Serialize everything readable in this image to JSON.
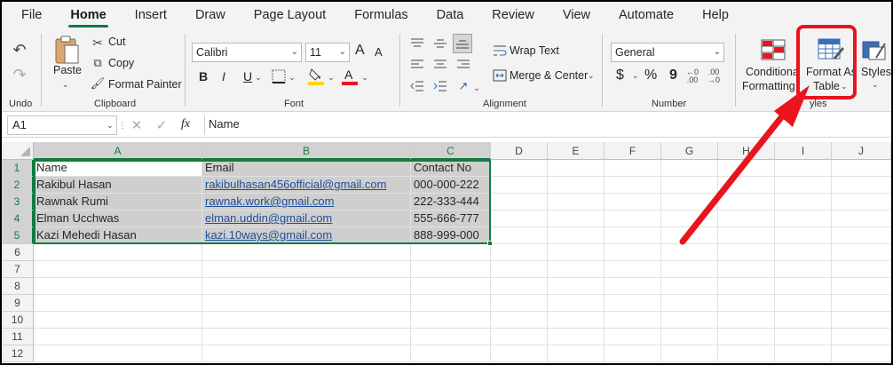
{
  "tabs": [
    "File",
    "Home",
    "Insert",
    "Draw",
    "Page Layout",
    "Formulas",
    "Data",
    "Review",
    "View",
    "Automate",
    "Help"
  ],
  "ribbon": {
    "undo_label": "Undo",
    "clipboard": {
      "paste": "Paste",
      "cut": "Cut",
      "copy": "Copy",
      "format_painter": "Format Painter",
      "label": "Clipboard"
    },
    "font": {
      "name": "Calibri",
      "size": "11",
      "bold": "B",
      "italic": "I",
      "underline": "U",
      "label": "Font",
      "grow": "A",
      "shrink": "A"
    },
    "alignment": {
      "wrap_text": "Wrap Text",
      "merge_center": "Merge & Center",
      "label": "Alignment"
    },
    "number": {
      "format": "General",
      "currency": "$",
      "percent": "%",
      "comma": "9",
      "label": "Number"
    },
    "styles": {
      "conditional_1": "Conditiona",
      "conditional_2": "Formatting",
      "format_as_table_1": "Format As",
      "format_as_table_2": "Table",
      "cell_styles": "Styles",
      "label": "yles"
    },
    "colors": {
      "highlight": "#e8141e",
      "accent": "#107c41",
      "font_color_bar": "#e8141e",
      "fill_color_bar": "#ffd400"
    }
  },
  "formula_bar": {
    "name_box": "A1",
    "fx": "fx",
    "value": "Name"
  },
  "sheet": {
    "columns": [
      "A",
      "B",
      "C",
      "D",
      "E",
      "F",
      "G",
      "H",
      "I",
      "J"
    ],
    "rows": [
      "1",
      "2",
      "3",
      "4",
      "5",
      "6",
      "7",
      "8",
      "9",
      "10",
      "11",
      "12"
    ],
    "data": [
      [
        "Name",
        "Email",
        "Contact No"
      ],
      [
        "Rakibul Hasan",
        "rakibulhasan456official@gmail.com",
        "000-000-222"
      ],
      [
        "Rawnak Rumi",
        "rawnak.work@gmail.com",
        "222-333-444"
      ],
      [
        "Elman Ucchwas",
        "elman.uddin@gmail.com",
        "555-666-777"
      ],
      [
        "Kazi Mehedi Hasan",
        "kazi.10ways@gmail.com",
        "888-999-000"
      ]
    ]
  }
}
